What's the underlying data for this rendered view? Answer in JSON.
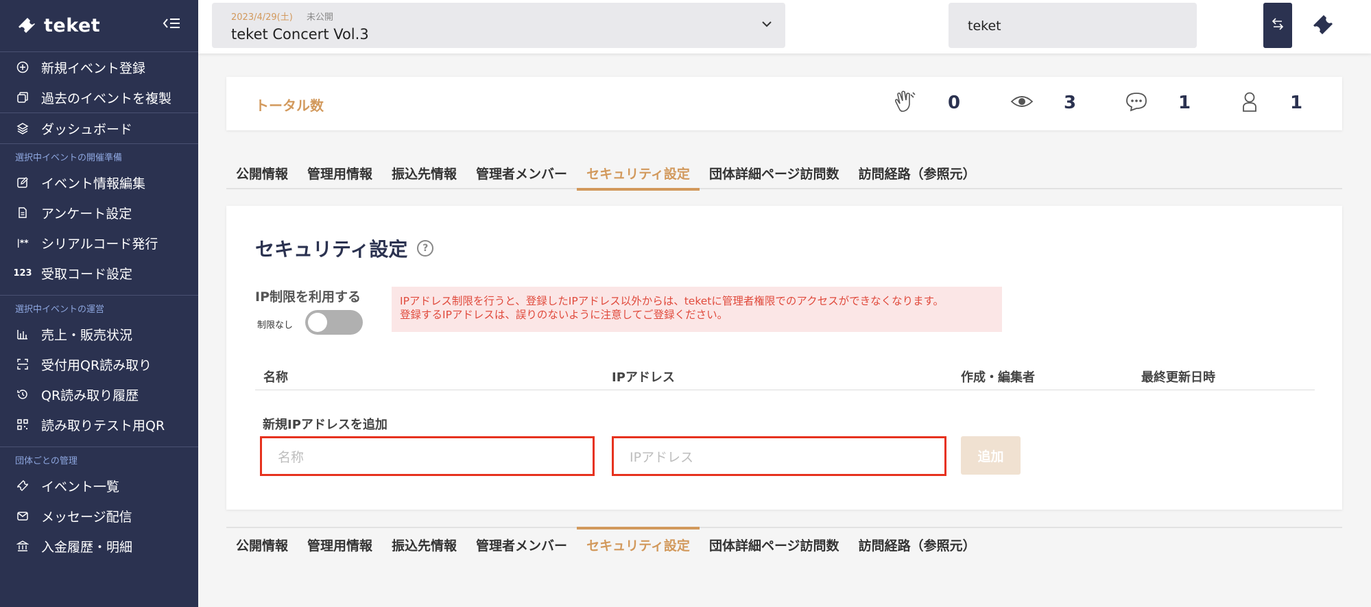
{
  "sidebar": {
    "brand": "teket",
    "collapse_icon": "collapse-left-icon",
    "top_items": [
      {
        "label": "新規イベント登録",
        "icon": "plus-circle-icon"
      },
      {
        "label": "過去のイベントを複製",
        "icon": "copy-icon"
      },
      {
        "label": "ダッシュボード",
        "icon": "layers-icon"
      }
    ],
    "section1": {
      "title": "選択中イベントの開催準備",
      "items": [
        {
          "label": "イベント情報編集",
          "icon": "edit-icon"
        },
        {
          "label": "アンケート設定",
          "icon": "document-icon"
        },
        {
          "label": "シリアルコード発行",
          "icon": "serial-icon"
        },
        {
          "label": "受取コード設定",
          "icon": "code-123-icon"
        }
      ]
    },
    "section2": {
      "title": "選択中イベントの運営",
      "items": [
        {
          "label": "売上・販売状況",
          "icon": "bar-chart-icon"
        },
        {
          "label": "受付用QR読み取り",
          "icon": "scan-icon"
        },
        {
          "label": "QR読み取り履歴",
          "icon": "history-icon"
        },
        {
          "label": "読み取りテスト用QR",
          "icon": "qr-icon"
        }
      ]
    },
    "section3": {
      "title": "団体ごとの管理",
      "items": [
        {
          "label": "イベント一覧",
          "icon": "ticket-icon"
        },
        {
          "label": "メッセージ配信",
          "icon": "mail-icon"
        },
        {
          "label": "入金履歴・明細",
          "icon": "bank-icon"
        }
      ]
    }
  },
  "header": {
    "event_date": "2023/4/29(土)",
    "event_status": "未公開",
    "event_title": "teket Concert Vol.3",
    "org_name": "teket"
  },
  "totals": {
    "label": "トータル数",
    "stats": [
      {
        "icon": "clap-icon",
        "value": "0"
      },
      {
        "icon": "eye-icon",
        "value": "3"
      },
      {
        "icon": "comment-icon",
        "value": "1"
      },
      {
        "icon": "user-icon",
        "value": "1"
      }
    ]
  },
  "tabs": [
    {
      "label": "公開情報"
    },
    {
      "label": "管理用情報"
    },
    {
      "label": "振込先情報"
    },
    {
      "label": "管理者メンバー"
    },
    {
      "label": "セキュリティ設定",
      "active": true
    },
    {
      "label": "団体詳細ページ訪問数"
    },
    {
      "label": "訪問経路（参照元）"
    }
  ],
  "security": {
    "heading": "セキュリティ設定",
    "help": "?",
    "ip_limit_label": "IP制限を利用する",
    "toggle_caption": "制限なし",
    "toggle_on": false,
    "warning_line1": "IPアドレス制限を行うと、登録したIPアドレス以外からは、teketに管理者権限でのアクセスができなくなります。",
    "warning_line2": "登録するIPアドレスは、誤りのないように注意してご登録ください。",
    "columns": [
      "名称",
      "IPアドレス",
      "作成・編集者",
      "最終更新日時"
    ],
    "add_label": "新規IPアドレスを追加",
    "name_placeholder": "名称",
    "ip_placeholder": "IPアドレス",
    "add_button": "追加"
  },
  "colors": {
    "sidebar_bg": "#2b3250",
    "accent": "#d2995c",
    "warning_text": "#e04a3c",
    "warning_bg": "#fbe6e6",
    "highlight_border": "#e6321e"
  }
}
